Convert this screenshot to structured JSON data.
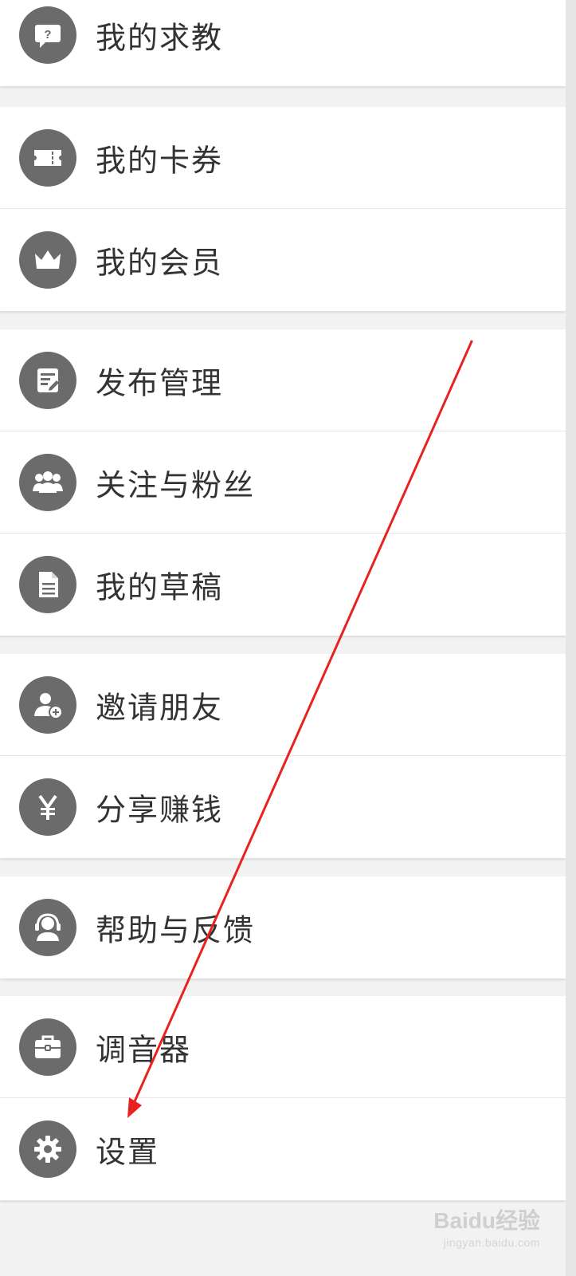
{
  "menu": {
    "groups": [
      {
        "items": [
          {
            "label": "我的求教",
            "icon": "help-bubble-icon"
          }
        ]
      },
      {
        "items": [
          {
            "label": "我的卡券",
            "icon": "ticket-icon"
          },
          {
            "label": "我的会员",
            "icon": "crown-icon"
          }
        ]
      },
      {
        "items": [
          {
            "label": "发布管理",
            "icon": "edit-document-icon"
          },
          {
            "label": "关注与粉丝",
            "icon": "people-group-icon"
          },
          {
            "label": "我的草稿",
            "icon": "draft-document-icon"
          }
        ]
      },
      {
        "items": [
          {
            "label": "邀请朋友",
            "icon": "add-friend-icon"
          },
          {
            "label": "分享赚钱",
            "icon": "yen-icon"
          }
        ]
      },
      {
        "items": [
          {
            "label": "帮助与反馈",
            "icon": "headset-support-icon"
          }
        ]
      },
      {
        "items": [
          {
            "label": "调音器",
            "icon": "toolbox-icon"
          },
          {
            "label": "设置",
            "icon": "gear-icon"
          }
        ]
      }
    ]
  },
  "overlay": {
    "arrow_color": "#e8231f"
  },
  "colors": {
    "icon_bg": "#6b6b6b",
    "background": "#f2f2f2",
    "text": "#333333"
  },
  "watermark": {
    "brand": "Baidu经验",
    "url": "jingyan.baidu.com"
  }
}
